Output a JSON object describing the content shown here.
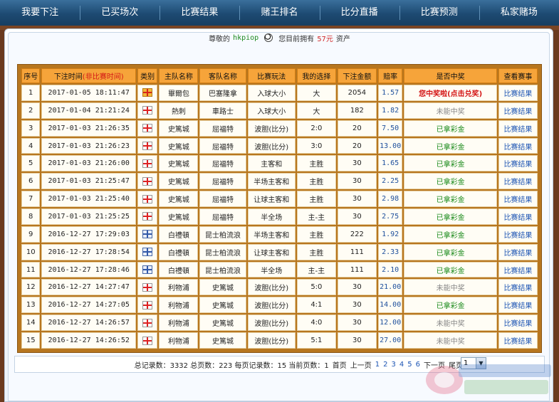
{
  "nav": [
    {
      "label": "我要下注"
    },
    {
      "label": "已买场次"
    },
    {
      "label": "比赛结果"
    },
    {
      "label": "赌王排名"
    },
    {
      "label": "比分直播"
    },
    {
      "label": "比赛预测"
    },
    {
      "label": "私家赌场"
    }
  ],
  "greeting": {
    "prefix": "尊敬的",
    "username": "hkpiop",
    "middle": "您目前拥有",
    "amount": "57元",
    "suffix": "资产"
  },
  "table": {
    "headers": {
      "no": "序号",
      "time": "下注时间",
      "time_note": "(非比赛时间)",
      "category": "类别",
      "home": "主队名称",
      "away": "客队名称",
      "play": "比赛玩法",
      "choice": "我的选择",
      "amount": "下注金额",
      "odds": "赔率",
      "result": "是否中奖",
      "view": "查看赛事"
    },
    "rows": [
      {
        "no": "1",
        "time": "2017-01-05 18:11:47",
        "flag": "gold",
        "home": "畢爾包",
        "away": "巴塞隆拿",
        "play": "入球大小",
        "choice": "大",
        "amount": "2054",
        "odds": "1.57",
        "result": "您中奖啦(点击兑奖)",
        "result_type": "win-red",
        "view": "比赛结果"
      },
      {
        "no": "2",
        "time": "2017-01-04 21:21:24",
        "flag": "plain",
        "home": "熱刺",
        "away": "車路士",
        "play": "入球大小",
        "choice": "大",
        "amount": "182",
        "odds": "1.82",
        "result": "未能中奖",
        "result_type": "lose",
        "view": "比赛结果"
      },
      {
        "no": "3",
        "time": "2017-01-03 21:26:35",
        "flag": "plain",
        "home": "史篤城",
        "away": "屈福特",
        "play": "波胆(比分)",
        "choice": "2:0",
        "amount": "20",
        "odds": "7.50",
        "result": "已拿彩金",
        "result_type": "win-green",
        "view": "比赛结果"
      },
      {
        "no": "4",
        "time": "2017-01-03 21:26:23",
        "flag": "plain",
        "home": "史篤城",
        "away": "屈福特",
        "play": "波胆(比分)",
        "choice": "3:0",
        "amount": "20",
        "odds": "13.00",
        "result": "已拿彩金",
        "result_type": "win-green",
        "view": "比赛结果"
      },
      {
        "no": "5",
        "time": "2017-01-03 21:26:00",
        "flag": "plain",
        "home": "史篤城",
        "away": "屈福特",
        "play": "主客和",
        "choice": "主胜",
        "amount": "30",
        "odds": "1.65",
        "result": "已拿彩金",
        "result_type": "win-green",
        "view": "比赛结果"
      },
      {
        "no": "6",
        "time": "2017-01-03 21:25:47",
        "flag": "plain",
        "home": "史篤城",
        "away": "屈福特",
        "play": "半场主客和",
        "choice": "主胜",
        "amount": "30",
        "odds": "2.25",
        "result": "已拿彩金",
        "result_type": "win-green",
        "view": "比赛结果"
      },
      {
        "no": "7",
        "time": "2017-01-03 21:25:40",
        "flag": "plain",
        "home": "史篤城",
        "away": "屈福特",
        "play": "让球主客和",
        "choice": "主胜",
        "amount": "30",
        "odds": "2.98",
        "result": "已拿彩金",
        "result_type": "win-green",
        "view": "比赛结果"
      },
      {
        "no": "8",
        "time": "2017-01-03 21:25:25",
        "flag": "plain",
        "home": "史篤城",
        "away": "屈福特",
        "play": "半全场",
        "choice": "主-主",
        "amount": "30",
        "odds": "2.75",
        "result": "已拿彩金",
        "result_type": "win-green",
        "view": "比赛结果"
      },
      {
        "no": "9",
        "time": "2016-12-27 17:29:03",
        "flag": "blue",
        "home": "白禮頓",
        "away": "昆士柏流浪",
        "play": "半场主客和",
        "choice": "主胜",
        "amount": "222",
        "odds": "1.92",
        "result": "已拿彩金",
        "result_type": "win-green",
        "view": "比赛结果"
      },
      {
        "no": "10",
        "time": "2016-12-27 17:28:54",
        "flag": "blue",
        "home": "白禮頓",
        "away": "昆士柏流浪",
        "play": "让球主客和",
        "choice": "主胜",
        "amount": "111",
        "odds": "2.33",
        "result": "已拿彩金",
        "result_type": "win-green",
        "view": "比赛结果"
      },
      {
        "no": "11",
        "time": "2016-12-27 17:28:46",
        "flag": "blue",
        "home": "白禮頓",
        "away": "昆士柏流浪",
        "play": "半全场",
        "choice": "主-主",
        "amount": "111",
        "odds": "2.10",
        "result": "已拿彩金",
        "result_type": "win-green",
        "view": "比赛结果"
      },
      {
        "no": "12",
        "time": "2016-12-27 14:27:47",
        "flag": "plain",
        "home": "利物浦",
        "away": "史篤城",
        "play": "波胆(比分)",
        "choice": "5:0",
        "amount": "30",
        "odds": "21.00",
        "result": "未能中奖",
        "result_type": "lose",
        "view": "比赛结果"
      },
      {
        "no": "13",
        "time": "2016-12-27 14:27:05",
        "flag": "plain",
        "home": "利物浦",
        "away": "史篤城",
        "play": "波胆(比分)",
        "choice": "4:1",
        "amount": "30",
        "odds": "14.00",
        "result": "已拿彩金",
        "result_type": "win-green",
        "view": "比赛结果"
      },
      {
        "no": "14",
        "time": "2016-12-27 14:26:57",
        "flag": "plain",
        "home": "利物浦",
        "away": "史篤城",
        "play": "波胆(比分)",
        "choice": "4:0",
        "amount": "30",
        "odds": "12.00",
        "result": "未能中奖",
        "result_type": "lose",
        "view": "比赛结果"
      },
      {
        "no": "15",
        "time": "2016-12-27 14:26:52",
        "flag": "plain",
        "home": "利物浦",
        "away": "史篤城",
        "play": "波胆(比分)",
        "choice": "5:1",
        "amount": "30",
        "odds": "27.00",
        "result": "未能中奖",
        "result_type": "lose",
        "view": "比赛结果"
      }
    ]
  },
  "pager": {
    "summary": "总记录数：3332 总页数：223 每页记录数：15 当前页数：1",
    "first": "首页",
    "prev": "上一页",
    "pages": [
      "1",
      "2",
      "3",
      "4",
      "5",
      "6"
    ],
    "next": "下一页",
    "last": "尾页",
    "select_value": "1"
  },
  "colors": {
    "nav_bg": "#1d4a72",
    "header_bg": "#f6a43a",
    "win_red": "#d41616",
    "win_green": "#1a8a1a",
    "link_blue": "#1d55b4"
  }
}
